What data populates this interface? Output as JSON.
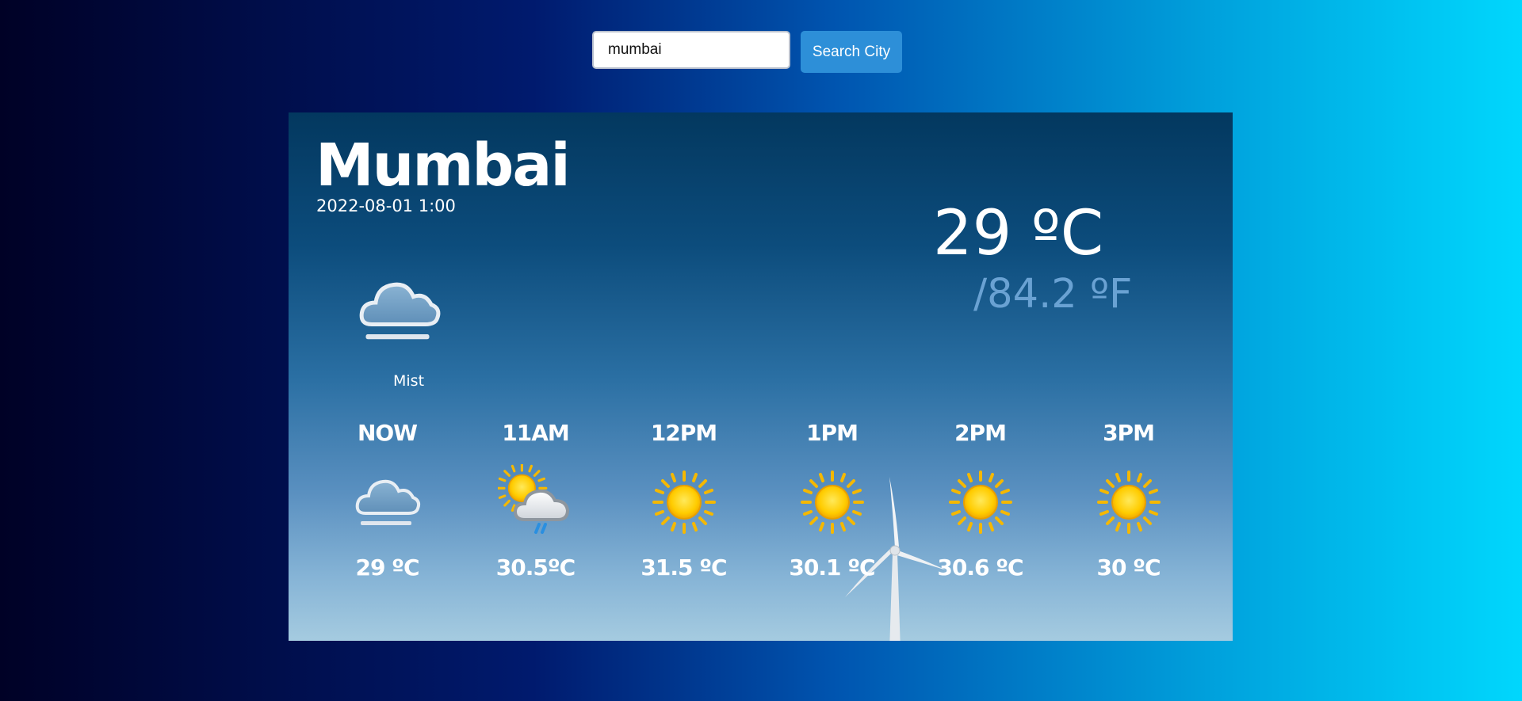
{
  "search": {
    "value": "mumbai",
    "button_label": "Search City"
  },
  "current": {
    "city": "Mumbai",
    "datetime": "2022-08-01 1:00",
    "condition": "Mist",
    "condition_icon": "mist-icon",
    "temp_c": "29 ºC",
    "temp_f": "/84.2 ºF"
  },
  "forecast": [
    {
      "time": "NOW",
      "temp": "29 ºC",
      "icon": "mist-icon"
    },
    {
      "time": "11AM",
      "temp": "30.5ºC",
      "icon": "patchy-rain-icon"
    },
    {
      "time": "12PM",
      "temp": "31.5 ºC",
      "icon": "sun-icon"
    },
    {
      "time": "1PM",
      "temp": "30.1 ºC",
      "icon": "sun-icon"
    },
    {
      "time": "2PM",
      "temp": "30.6 ºC",
      "icon": "sun-icon"
    },
    {
      "time": "3PM",
      "temp": "30 ºC",
      "icon": "sun-icon"
    }
  ]
}
